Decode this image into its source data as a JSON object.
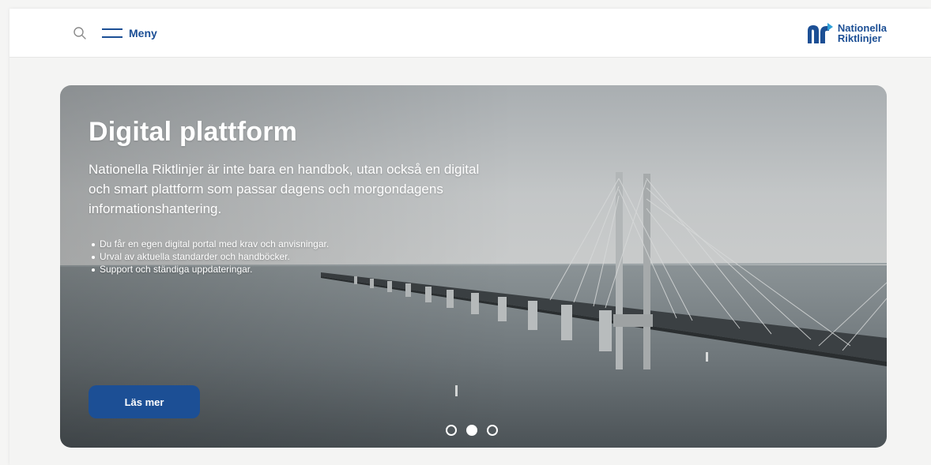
{
  "header": {
    "menu_label": "Meny",
    "logo_line1": "Nationella",
    "logo_line2": "Riktlinjer",
    "icons": [
      "search-icon",
      "menu-icon",
      "logo-mark-icon"
    ]
  },
  "hero": {
    "title": "Digital plattform",
    "description": "Nationella Riktlinjer är inte bara en handbok, utan också en digital och smart plattform som passar dagens och morgondagens informationshantering.",
    "bullets": [
      "Du får en egen digital portal med krav och anvisningar.",
      "Urval av aktuella standarder och handböcker.",
      "Support och ständiga uppdateringar."
    ],
    "cta_label": "Läs mer"
  },
  "carousel": {
    "slide_count": 3,
    "active_slide": 2
  },
  "colors": {
    "brand": "#1c4f95",
    "page_bg": "#f4f4f3",
    "header_bg": "#ffffff"
  }
}
